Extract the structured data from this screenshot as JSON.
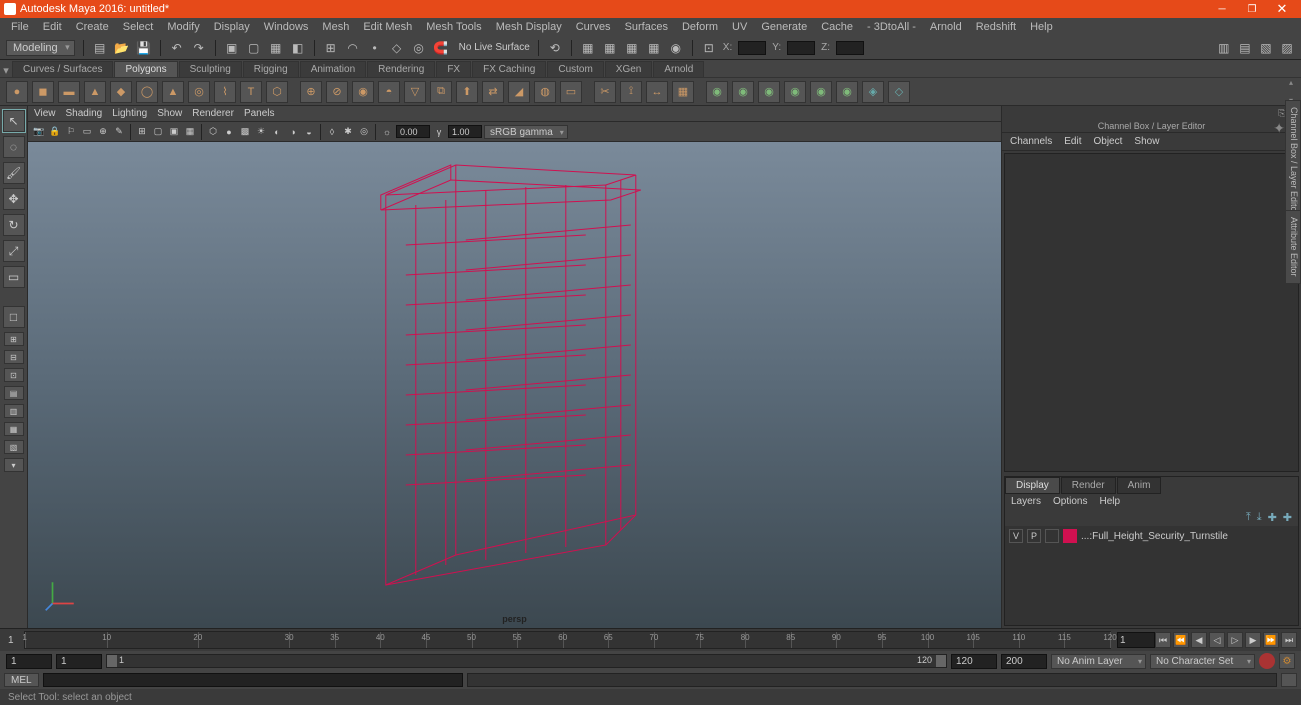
{
  "title": "Autodesk Maya 2016: untitled*",
  "menubar": [
    "File",
    "Edit",
    "Create",
    "Select",
    "Modify",
    "Display",
    "Windows",
    "Mesh",
    "Edit Mesh",
    "Mesh Tools",
    "Mesh Display",
    "Curves",
    "Surfaces",
    "Deform",
    "UV",
    "Generate",
    "Cache",
    "- 3DtoAll -",
    "Arnold",
    "Redshift",
    "Help"
  ],
  "workspace": "Modeling",
  "no_live_surface": "No Live Surface",
  "coords": {
    "x_label": "X:",
    "y_label": "Y:",
    "z_label": "Z:",
    "x": "",
    "y": "",
    "z": ""
  },
  "shelf_tabs": [
    "Curves / Surfaces",
    "Polygons",
    "Sculpting",
    "Rigging",
    "Animation",
    "Rendering",
    "FX",
    "FX Caching",
    "Custom",
    "XGen",
    "Arnold"
  ],
  "active_shelf_tab": "Polygons",
  "panel_menu": [
    "View",
    "Shading",
    "Lighting",
    "Show",
    "Renderer",
    "Panels"
  ],
  "panel_fields": {
    "near": "0.00",
    "far": "1.00"
  },
  "color_mgmt": "sRGB gamma",
  "camera_label": "persp",
  "channel_title": "Channel Box / Layer Editor",
  "channel_menu": [
    "Channels",
    "Edit",
    "Object",
    "Show"
  ],
  "side_tab_1": "Channel Box / Layer Editor",
  "side_tab_2": "Attribute Editor",
  "layer_tabs": [
    "Display",
    "Render",
    "Anim"
  ],
  "layer_menu": [
    "Layers",
    "Options",
    "Help"
  ],
  "layer_item": {
    "vis": "V",
    "play": "P",
    "name": "...:Full_Height_Security_Turnstile"
  },
  "timeline": {
    "start_outer": "1",
    "start_inner": "1",
    "current": "1",
    "end_inner": "120",
    "end_outer": "200",
    "slider_end": "120"
  },
  "timeline_ticks": [
    1,
    10,
    20,
    30,
    35,
    40,
    45,
    50,
    55,
    60,
    65,
    70,
    75,
    80,
    85,
    90,
    95,
    100,
    105,
    110,
    115,
    120
  ],
  "anim_layer": "No Anim Layer",
  "char_set": "No Character Set",
  "cmd_lang": "MEL",
  "help_text": "Select Tool: select an object"
}
